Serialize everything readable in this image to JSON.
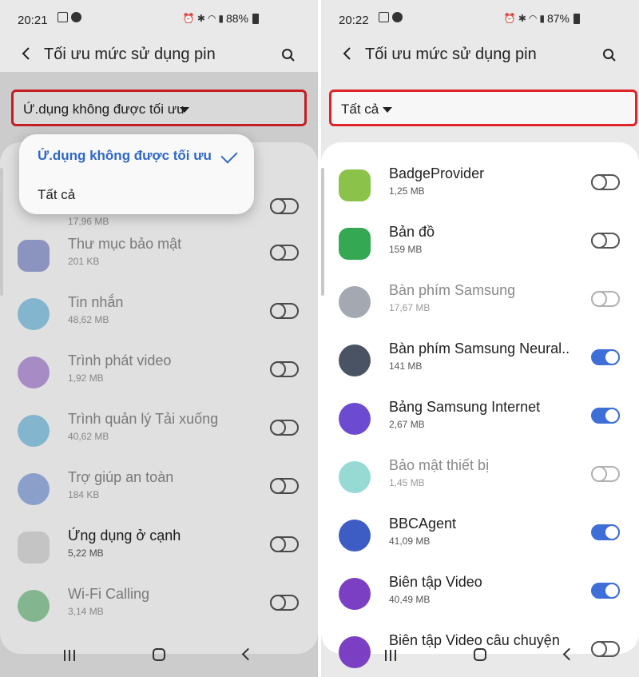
{
  "left": {
    "status": {
      "time": "20:21",
      "battery": "88%"
    },
    "title": "Tối ưu mức sử dụng pin",
    "filter_label": "Ứ.dụng không được tối ưu",
    "dropdown": {
      "options": [
        "Ứ.dụng không được tối ưu",
        "Tất cả"
      ],
      "selected": "Ứ.dụng không được tối ưu"
    },
    "partial_size": "17,96 MB",
    "apps": [
      {
        "name": "Thư mục bảo mật",
        "size": "201 KB",
        "icon": "secure-folder-icon",
        "color": "#3f51b5",
        "enabled": false
      },
      {
        "name": "Tin nhắn",
        "size": "48,62 MB",
        "icon": "messages-icon",
        "color": "#2f9fd8",
        "enabled": false
      },
      {
        "name": "Trình phát video",
        "size": "1,92 MB",
        "icon": "video-player-icon",
        "color": "#7b3fc4",
        "enabled": false
      },
      {
        "name": "Trình quản lý Tải xuống",
        "size": "40,62 MB",
        "icon": "download-manager-icon",
        "color": "#2f9fd8",
        "enabled": false
      },
      {
        "name": "Trợ giúp an toàn",
        "size": "184 KB",
        "icon": "safety-assistance-icon",
        "color": "#3d6fd1",
        "enabled": false
      },
      {
        "name": "Ứng dụng ở cạnh",
        "size": "5,22 MB",
        "icon": "edge-apps-icon",
        "color": "#e0e0e0",
        "enabled": false
      },
      {
        "name": "Wi-Fi Calling",
        "size": "3,14 MB",
        "icon": "wifi-calling-icon",
        "color": "#2e9e48",
        "enabled": false
      }
    ]
  },
  "right": {
    "status": {
      "time": "20:22",
      "battery": "87%"
    },
    "title": "Tối ưu mức sử dụng pin",
    "filter_label": "Tất cả",
    "apps": [
      {
        "name": "BadgeProvider",
        "size": "1,25 MB",
        "icon": "android-icon",
        "color": "#8bc34a",
        "enabled": false,
        "dim": false
      },
      {
        "name": "Bản đồ",
        "size": "159 MB",
        "icon": "maps-icon",
        "color": "#34a853",
        "enabled": false,
        "dim": false
      },
      {
        "name": "Bàn phím Samsung",
        "size": "17,67 MB",
        "icon": "keyboard-icon",
        "color": "#4a5363",
        "enabled": false,
        "dim": true
      },
      {
        "name": "Bàn phím Samsung Neural..",
        "size": "141 MB",
        "icon": "keyboard-icon",
        "color": "#4a5363",
        "enabled": true,
        "dim": false
      },
      {
        "name": "Bảng Samsung Internet",
        "size": "2,67 MB",
        "icon": "internet-browser-icon",
        "color": "#6c4bd1",
        "enabled": true,
        "dim": false
      },
      {
        "name": "Bảo mật thiết bị",
        "size": "1,45 MB",
        "icon": "device-security-icon",
        "color": "#2fb3a8",
        "enabled": false,
        "dim": true
      },
      {
        "name": "BBCAgent",
        "size": "41,09 MB",
        "icon": "bbcagent-icon",
        "color": "#3d5dc4",
        "enabled": true,
        "dim": false
      },
      {
        "name": "Biên tập Video",
        "size": "40,49 MB",
        "icon": "video-editor-icon",
        "color": "#7b3fc4",
        "enabled": true,
        "dim": false
      },
      {
        "name": "Biên tập Video câu chuyện",
        "size": "",
        "icon": "story-video-editor-icon",
        "color": "#7b3fc4",
        "enabled": false,
        "dim": false
      }
    ]
  }
}
